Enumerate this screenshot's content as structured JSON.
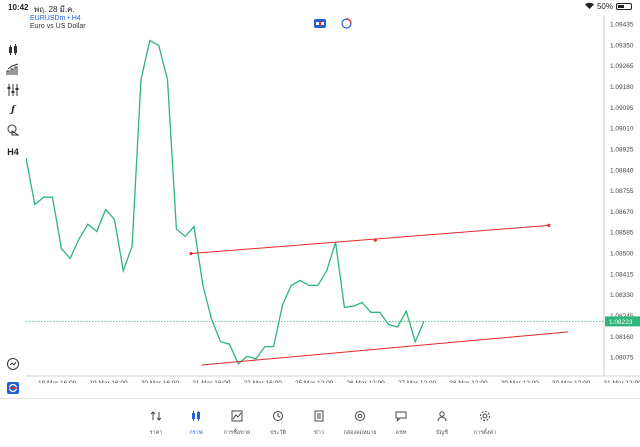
{
  "status_bar": {
    "time": "10:42",
    "date": "พฤ. 28 มี.ค.",
    "battery": "50%"
  },
  "symbol": {
    "title": "EURUSDm • H4",
    "description": "Euro vs US Dollar"
  },
  "left_toolbar": {
    "timeframe": "H4",
    "icons": [
      "crosshair-icon",
      "candles-icon",
      "indicators-icon",
      "objects-icon",
      "function-icon",
      "shapes-icon",
      "timeframe-icon",
      "speed-test-icon",
      "app-logo-icon"
    ]
  },
  "colors": {
    "price_line": "#2fb47a",
    "trend_line": "#e8282a",
    "current_price_bg": "#2fb47a",
    "accent": "#1e62d8"
  },
  "price_axis": {
    "ticks": [
      "1.09435",
      "1.09350",
      "1.09265",
      "1.09180",
      "1.09095",
      "1.09010",
      "1.08925",
      "1.08840",
      "1.08755",
      "1.08670",
      "1.08585",
      "1.08500",
      "1.08415",
      "1.08330",
      "1.08245",
      "1.08160",
      "1.08075"
    ],
    "current_price": "1.08223"
  },
  "time_axis": {
    "ticks": [
      "18 Mar 16:00",
      "19 Mar 16:00",
      "20 Mar 16:00",
      "21 Mar 16:00",
      "22 Mar 16:00",
      "25 Mar 12:00",
      "26 Mar 12:00",
      "27 Mar 12:00",
      "28 Mar 12:00",
      "29 Mar 12:00",
      "30 Mar 12:00",
      "31 Mar 12:00"
    ]
  },
  "chart_data": {
    "type": "line",
    "symbol": "EURUSDm",
    "timeframe": "H4",
    "price_series": [
      1.0889,
      1.087,
      1.0873,
      1.0873,
      1.0852,
      1.0848,
      1.0856,
      1.0862,
      1.0859,
      1.0868,
      1.0864,
      1.0843,
      1.0853,
      1.0921,
      1.0937,
      1.0935,
      1.0921,
      1.086,
      1.0857,
      1.0861,
      1.0837,
      1.0823,
      1.0814,
      1.0813,
      1.0805,
      1.0808,
      1.0807,
      1.0812,
      1.0812,
      1.0829,
      1.0837,
      1.0839,
      1.0837,
      1.0837,
      1.0843,
      1.08545,
      1.0828,
      1.08285,
      1.083,
      1.0826,
      1.0826,
      1.0821,
      1.082,
      1.08265,
      1.0814,
      1.08223
    ],
    "current_price": 1.08223,
    "y_range": [
      1.08,
      1.0947
    ],
    "trend_lines": [
      {
        "from": [
          7.7,
          1.085
        ],
        "to": [
          24.4,
          1.08615
        ],
        "points": [
          [
            7.7,
            1.085
          ],
          [
            16.3,
            1.08555
          ],
          [
            24.4,
            1.08615
          ]
        ]
      },
      {
        "from": [
          8.2,
          1.08045
        ],
        "to": [
          25.3,
          1.0818
        ],
        "points": []
      }
    ],
    "x_range": [
      0,
      27.3
    ],
    "grid": false
  },
  "tabs": [
    {
      "label": "ราคา",
      "icon": "quotes-icon"
    },
    {
      "label": "กราฟ",
      "icon": "chart-icon",
      "active": true
    },
    {
      "label": "การซื้อขาย",
      "icon": "trade-icon"
    },
    {
      "label": "ประวัติ",
      "icon": "history-icon"
    },
    {
      "label": "ข่าว",
      "icon": "news-icon"
    },
    {
      "label": "กล่องจดหมาย",
      "icon": "mailbox-icon"
    },
    {
      "label": "แชท",
      "icon": "chat-icon"
    },
    {
      "label": "บัญชี",
      "icon": "account-icon"
    },
    {
      "label": "การตั้งค่า",
      "icon": "settings-icon"
    }
  ]
}
